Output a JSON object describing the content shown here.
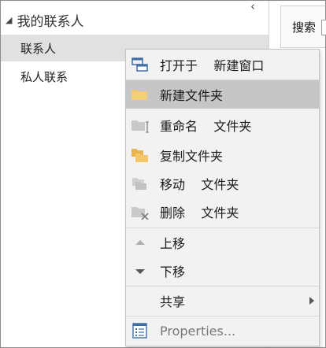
{
  "folder_pane": {
    "group_title": "我的联系人",
    "collapse_glyph": "‹",
    "expand_glyph": "◢",
    "items": [
      {
        "label": "联系人"
      },
      {
        "label": "私人联系"
      }
    ]
  },
  "search": {
    "label": "搜索"
  },
  "context_menu": {
    "items": [
      {
        "label": "打开于    新建窗口",
        "icon": "open-in-new-window-icon"
      },
      {
        "label": "新建文件夹",
        "icon": "new-folder-icon"
      },
      {
        "label": "重命名    文件夹",
        "icon": "rename-folder-icon"
      },
      {
        "label": "复制文件夹",
        "icon": "copy-folder-icon"
      },
      {
        "label": "移动    文件夹",
        "icon": "move-folder-icon"
      },
      {
        "label": "删除    文件夹",
        "icon": "delete-folder-icon"
      },
      {
        "label": "上移",
        "icon": "move-up-icon"
      },
      {
        "label": "下移",
        "icon": "move-down-icon"
      },
      {
        "label": "共享",
        "icon": "share-submenu-icon"
      },
      {
        "label": "Properties...",
        "icon": "properties-icon"
      }
    ]
  },
  "colors": {
    "selected_row": "#e1e1e1",
    "menu_bg": "#f2f2f2",
    "menu_highlight": "#c6c6c6",
    "folder_yellow": "#f4c768"
  }
}
